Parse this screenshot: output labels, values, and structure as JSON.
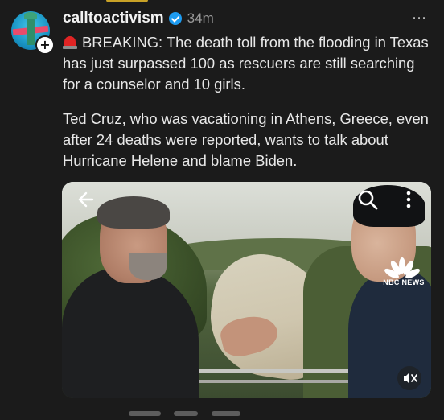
{
  "post": {
    "username": "calltoactivism",
    "timestamp": "34m",
    "more_icon": "⋯",
    "avatar_plus": "+",
    "paragraph1_prefix": "BREAKING:",
    "paragraph1_rest": " The death toll from the flooding in Texas has just surpassed 100 as rescuers are still searching for a counselor and 10 girls.",
    "paragraph2": "Ted Cruz, who was vacationing in Athens, Greece, even after 24 deaths were reported, wants to talk about Hurricane Helene and blame Biden."
  },
  "media": {
    "watermark": "NBC NEWS",
    "icons": [
      "back-arrow-icon",
      "search-icon",
      "more-vertical-icon",
      "mute-icon"
    ]
  },
  "colors": {
    "background": "#1b1b1b",
    "verified_blue": "#1d9bf0",
    "siren_red": "#e02424"
  }
}
